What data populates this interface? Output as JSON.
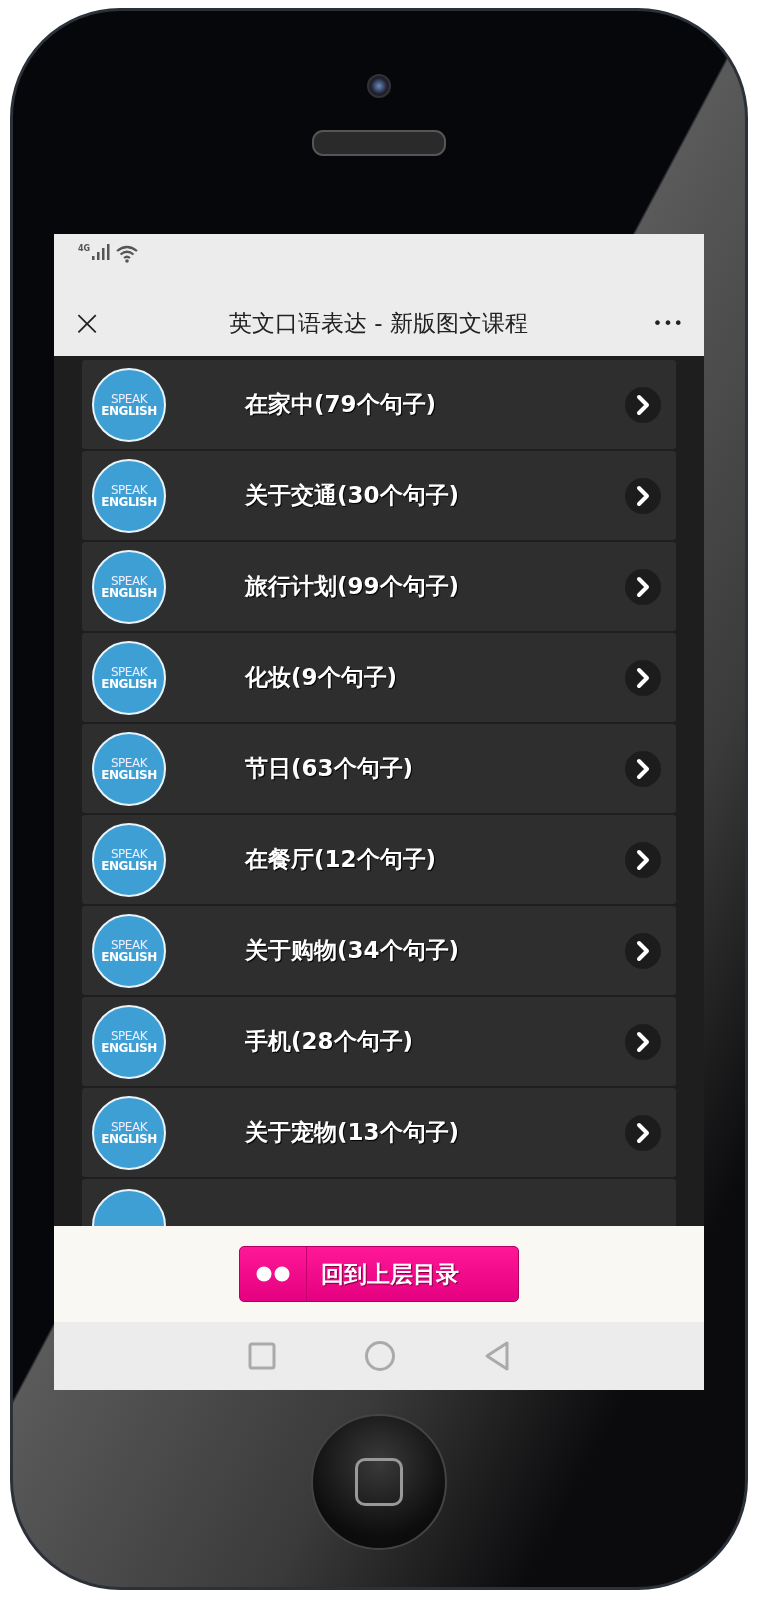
{
  "status_bar": {
    "network": "4G"
  },
  "nav_bar": {
    "close": "×",
    "title": "英文口语表达 - 新版图文课程",
    "more": "•••"
  },
  "lessons": [
    {
      "kind": "full",
      "logo_top": "SPEAK",
      "logo_bottom": "ENGLISH",
      "title": "在家中(79个句子)"
    },
    {
      "kind": "full",
      "logo_top": "SPEAK",
      "logo_bottom": "ENGLISH",
      "title": "关于交通(30个句子)"
    },
    {
      "kind": "full",
      "logo_top": "SPEAK",
      "logo_bottom": "ENGLISH",
      "title": "旅行计划(99个句子)"
    },
    {
      "kind": "full",
      "logo_top": "SPEAK",
      "logo_bottom": "ENGLISH",
      "title": "化妆(9个句子)"
    },
    {
      "kind": "full",
      "logo_top": "SPEAK",
      "logo_bottom": "ENGLISH",
      "title": "节日(63个句子)"
    },
    {
      "kind": "full",
      "logo_top": "SPEAK",
      "logo_bottom": "ENGLISH",
      "title": "在餐厅(12个句子)"
    },
    {
      "kind": "full",
      "logo_top": "SPEAK",
      "logo_bottom": "ENGLISH",
      "title": "关于购物(34个句子)"
    },
    {
      "kind": "full",
      "logo_top": "SPEAK",
      "logo_bottom": "ENGLISH",
      "title": "手机(28个句子)"
    },
    {
      "kind": "full",
      "logo_top": "SPEAK",
      "logo_bottom": "ENGLISH",
      "title": "关于宠物(13个句子)"
    },
    {
      "kind": "cut"
    }
  ],
  "back_button": {
    "label": "回到上层目录"
  }
}
